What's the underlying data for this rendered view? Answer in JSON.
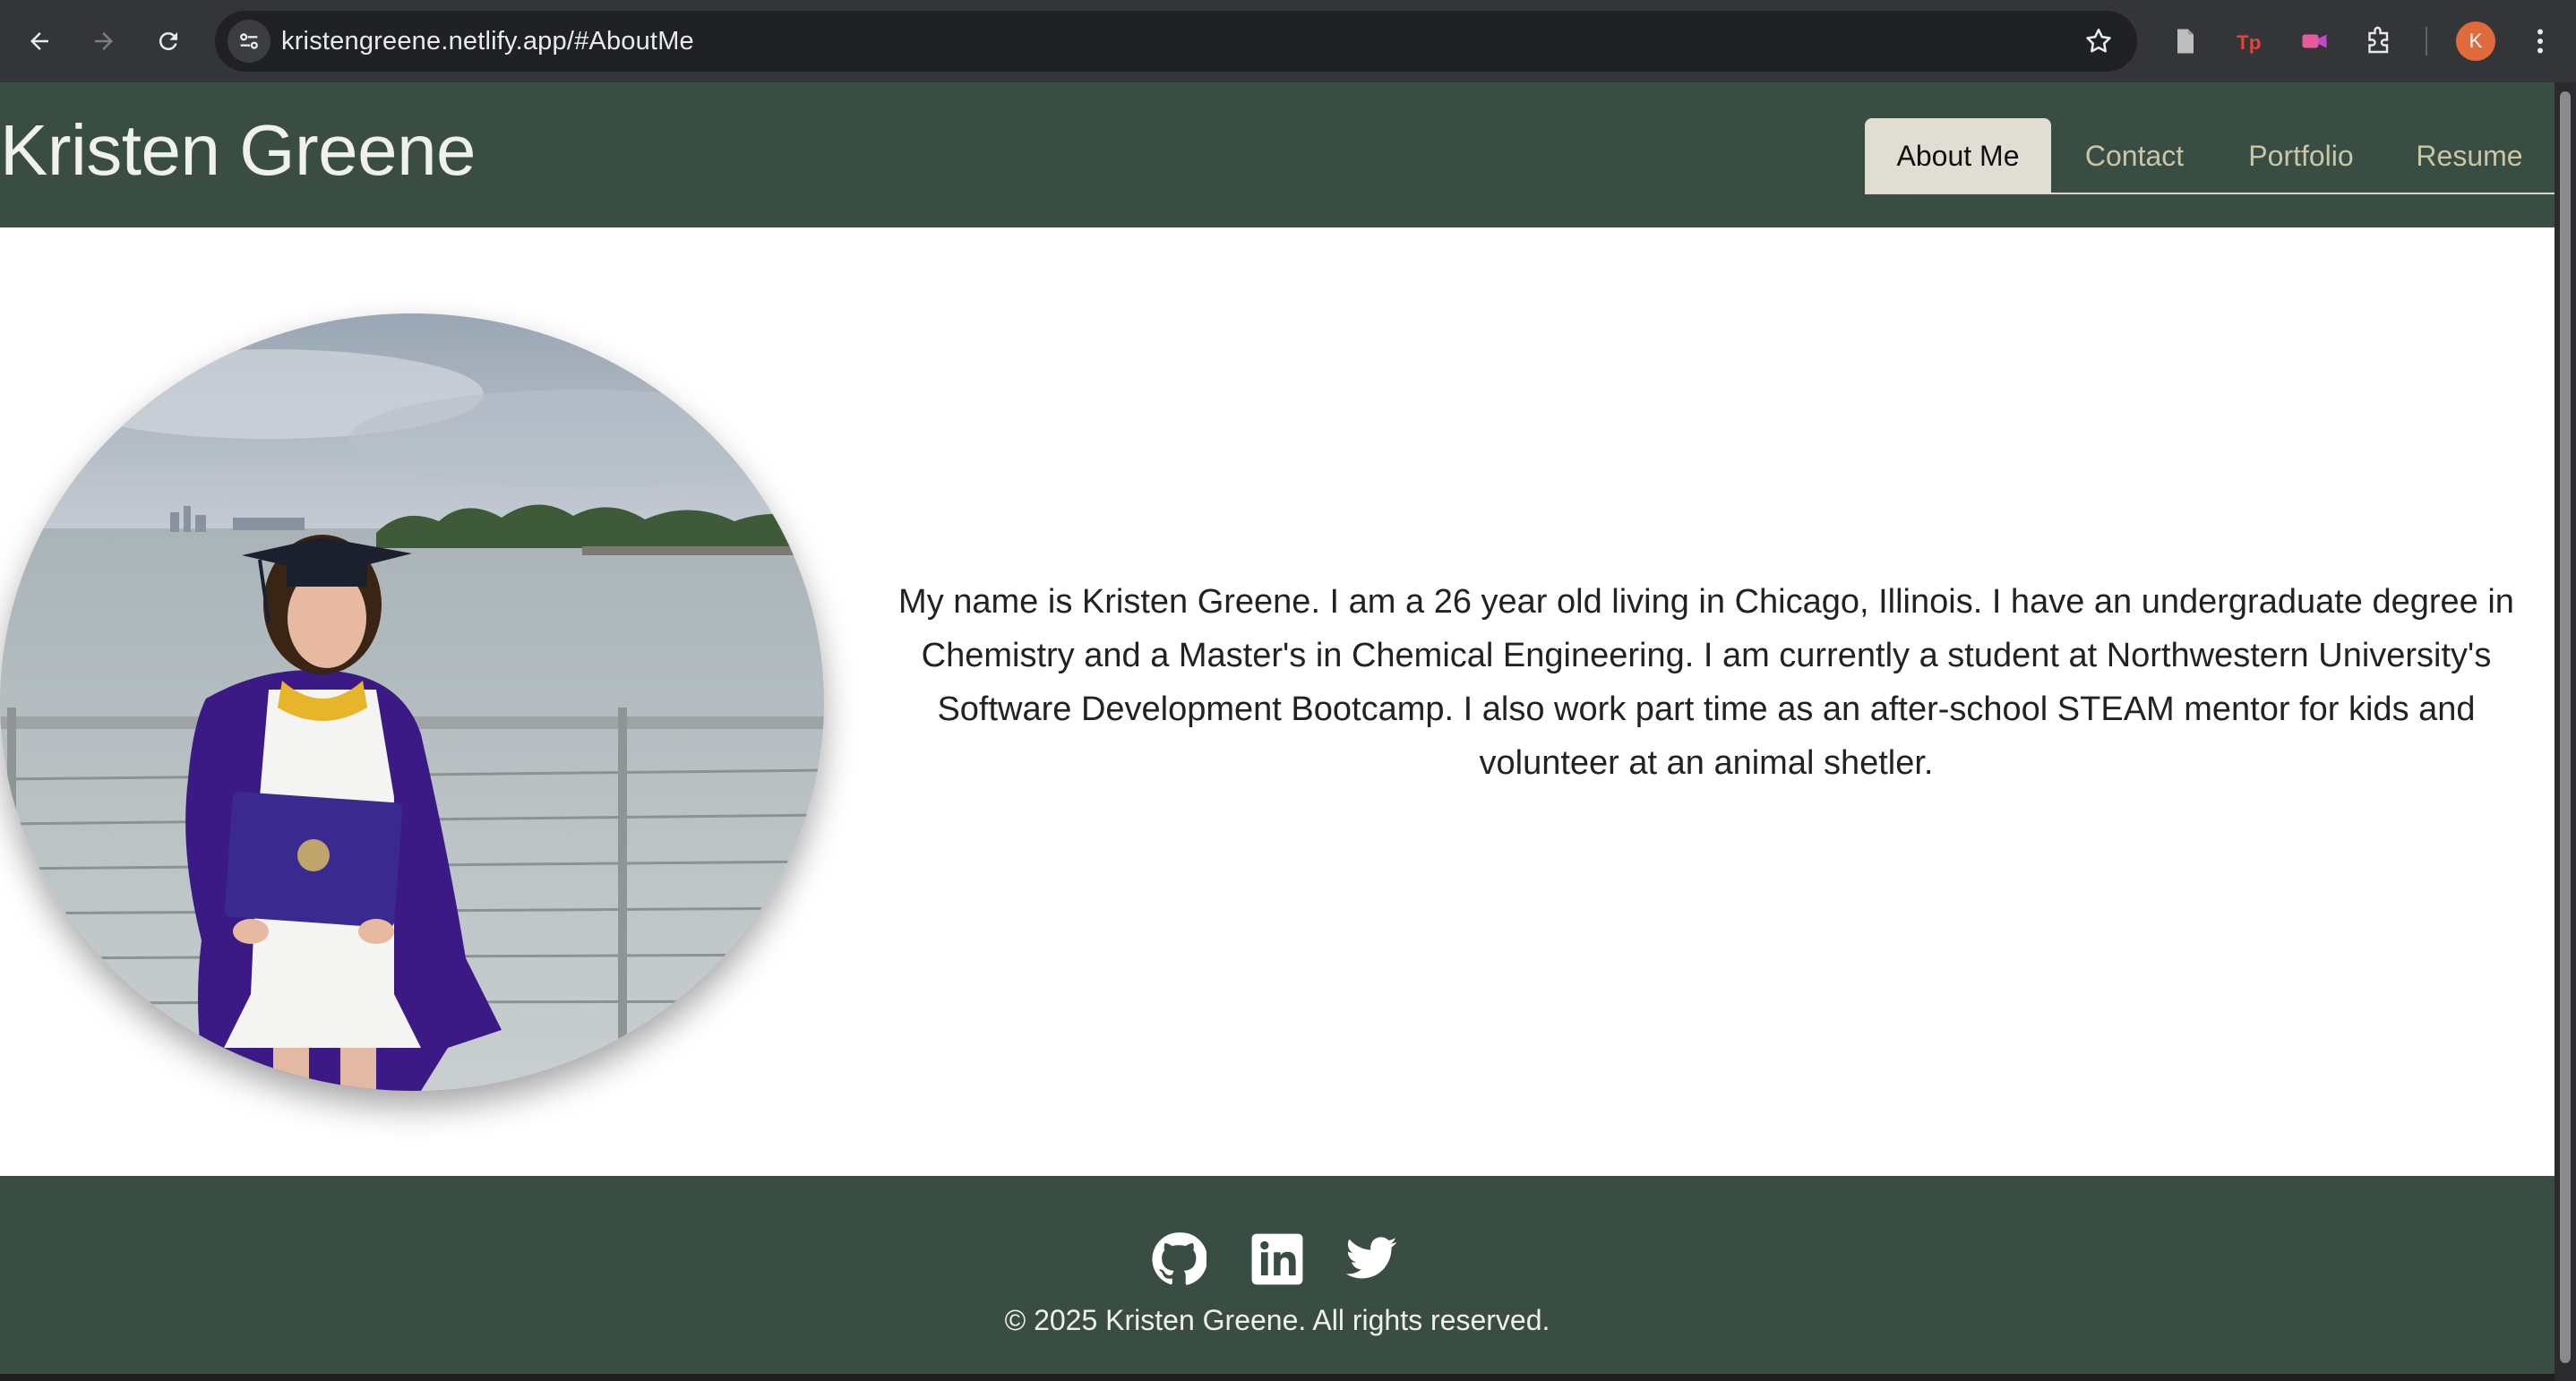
{
  "browser": {
    "url": "kristengreene.netlify.app/#AboutMe",
    "profile_initial": "K",
    "icons": [
      "back-icon",
      "forward-icon",
      "reload-icon",
      "site-settings-icon",
      "star-icon",
      "document-icon",
      "tp-extension-icon",
      "video-extension-icon",
      "puzzle-icon",
      "menu-icon"
    ]
  },
  "header": {
    "title": "Kristen Greene",
    "tabs": [
      {
        "label": "About Me",
        "active": true
      },
      {
        "label": "Contact",
        "active": false
      },
      {
        "label": "Portfolio",
        "active": false
      },
      {
        "label": "Resume",
        "active": false
      }
    ]
  },
  "main": {
    "bio": "My name is Kristen Greene. I am a 26 year old living in Chicago, Illinois. I have an undergraduate degree in Chemistry and a Master's in Chemical Engineering. I am currently a student at Northwestern University's Software Development Bootcamp. I also work part time as an after-school STEAM mentor for kids and volunteer at an animal shetler."
  },
  "footer": {
    "social": [
      "github-icon",
      "linkedin-icon",
      "twitter-icon"
    ],
    "copyright": "© 2025 Kristen Greene. All rights reserved."
  },
  "colors": {
    "header_bg": "#3a4d42",
    "tab_active_bg": "#e0ddd3",
    "tab_text": "#c8c6a8",
    "footer_bg": "#3a4d42"
  }
}
